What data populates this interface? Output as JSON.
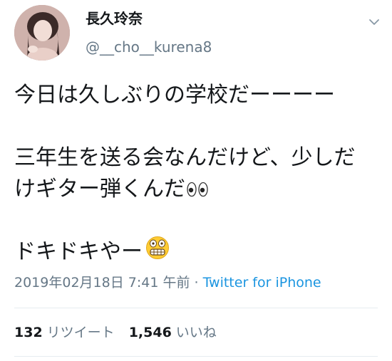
{
  "author": {
    "display_name": "長久玲奈",
    "handle": "@__cho__kurena8"
  },
  "tweet": {
    "lines": [
      "今日は久しぶりの学校だーーーー",
      "",
      "三年生を送る会なんだけど、少しだ",
      "けギター弾くんだ",
      "",
      "ドキドキやー"
    ],
    "emoji_after_line_4": "eyes-emoji",
    "emoji_after_line_6": "grimacing-face-emoji",
    "timestamp": "2019年02月18日 7:41 午前",
    "separator": " · ",
    "source": "Twitter for iPhone"
  },
  "stats": {
    "retweets_count": "132",
    "retweets_label": "リツイート",
    "likes_count": "1,546",
    "likes_label": "いいね"
  },
  "colors": {
    "text": "#14171a",
    "secondary": "#657786",
    "link": "#1b95e0",
    "divider": "#e6ecf0"
  }
}
